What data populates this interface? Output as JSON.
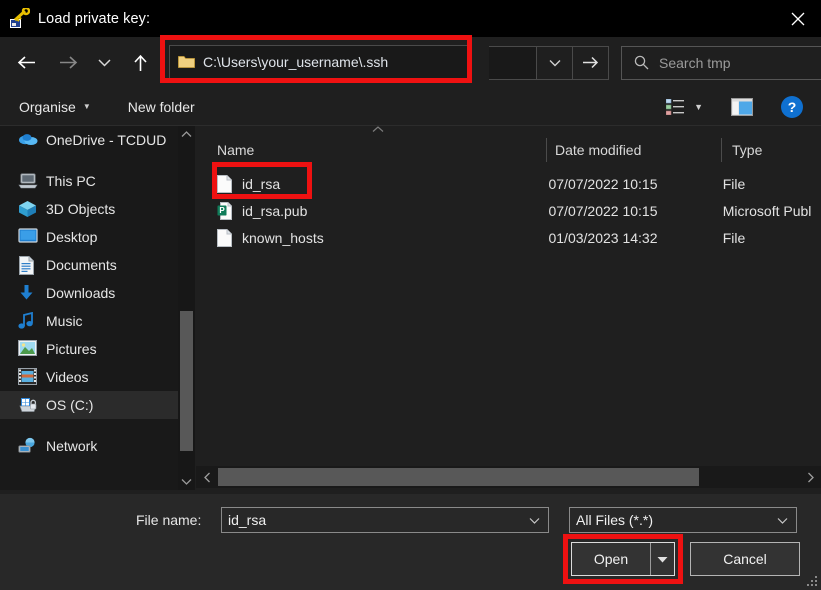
{
  "window": {
    "title": "Load private key:",
    "title_icon": "key-icon",
    "close_label": "✕"
  },
  "nav": {
    "back_icon": "arrow-left-icon",
    "forward_icon": "arrow-right-icon",
    "recent_icon": "chevron-down-icon",
    "up_icon": "arrow-up-icon",
    "dropdown_icon": "chevron-down-icon",
    "go_icon": "arrow-right-icon"
  },
  "address": {
    "path": "C:\\Users\\your_username\\.ssh",
    "folder_icon": "folder-icon"
  },
  "search": {
    "placeholder": "Search tmp",
    "icon": "search-icon"
  },
  "toolbar": {
    "organise_label": "Organise",
    "organise_caret": "▼",
    "new_folder_label": "New folder",
    "view_icon": "list-view-icon",
    "view_caret": "▼",
    "preview_icon": "preview-pane-icon",
    "help_label": "?"
  },
  "sidebar": {
    "scroll_up": "⌃",
    "scroll_down": "⌄",
    "items": [
      {
        "label": "OneDrive - TCDUD",
        "icon": "onedrive-icon",
        "indent": 0,
        "selected": false
      },
      {
        "label": "This PC",
        "icon": "this-pc-icon",
        "indent": 0,
        "selected": false
      },
      {
        "label": "3D Objects",
        "icon": "3d-objects-icon",
        "indent": 1,
        "selected": false
      },
      {
        "label": "Desktop",
        "icon": "desktop-icon",
        "indent": 1,
        "selected": false
      },
      {
        "label": "Documents",
        "icon": "documents-icon",
        "indent": 1,
        "selected": false
      },
      {
        "label": "Downloads",
        "icon": "downloads-icon",
        "indent": 1,
        "selected": false
      },
      {
        "label": "Music",
        "icon": "music-icon",
        "indent": 1,
        "selected": false
      },
      {
        "label": "Pictures",
        "icon": "pictures-icon",
        "indent": 1,
        "selected": false
      },
      {
        "label": "Videos",
        "icon": "videos-icon",
        "indent": 1,
        "selected": false
      },
      {
        "label": "OS (C:)",
        "icon": "drive-icon",
        "indent": 1,
        "selected": true
      },
      {
        "label": "Network",
        "icon": "network-icon",
        "indent": 0,
        "selected": false
      }
    ]
  },
  "filelist": {
    "sort_indicator": "⌃",
    "columns": [
      "Name",
      "Date modified",
      "Type"
    ],
    "rows": [
      {
        "name": "id_rsa",
        "date": "07/07/2022 10:15",
        "type": "File",
        "icon": "file-icon",
        "highlighted": true
      },
      {
        "name": "id_rsa.pub",
        "date": "07/07/2022 10:15",
        "type": "Microsoft Publ",
        "icon": "publisher-file-icon",
        "highlighted": false
      },
      {
        "name": "known_hosts",
        "date": "01/03/2023 14:32",
        "type": "File",
        "icon": "file-icon",
        "highlighted": false
      }
    ]
  },
  "hscroll": {
    "left_icon": "‹",
    "right_icon": "›"
  },
  "bottom": {
    "filename_label": "File name:",
    "filename_value": "id_rsa",
    "filename_caret": "⌄",
    "filetype_value": "All Files (*.*)",
    "filetype_caret": "⌄",
    "open_label": "Open",
    "open_split_caret": "▼",
    "cancel_label": "Cancel"
  },
  "colors": {
    "annotation_red": "#ee1111",
    "accent_blue": "#0f70d0",
    "window_bg": "#1f1f1f",
    "titlebar_bg": "#000000",
    "bottom_bg": "#282828"
  }
}
